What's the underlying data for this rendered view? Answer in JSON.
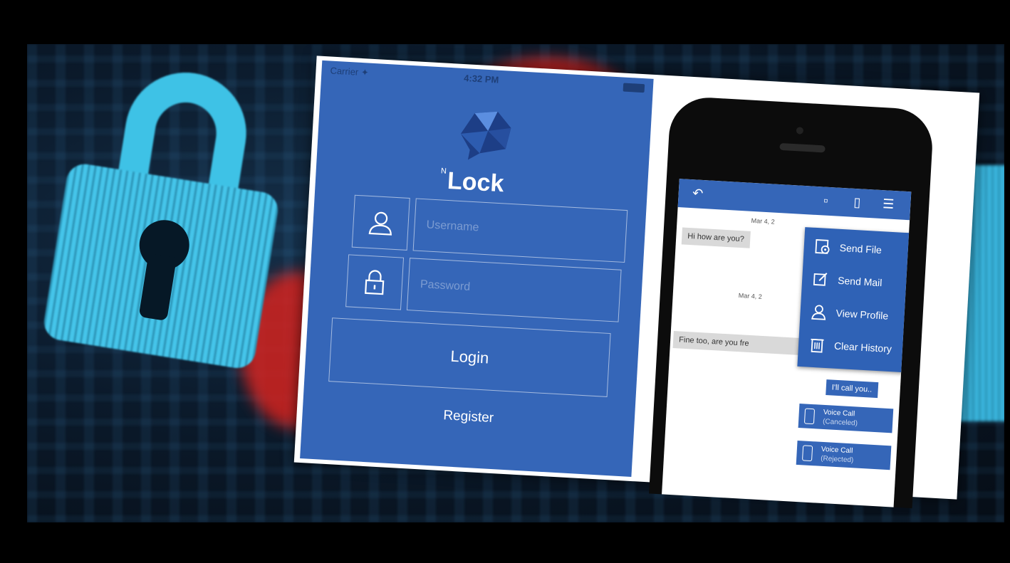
{
  "status_bar": {
    "carrier": "Carrier ✦",
    "time": "4:32 PM"
  },
  "brand": {
    "prefix": "N",
    "name": "Lock"
  },
  "login_form": {
    "username_placeholder": "Username",
    "password_placeholder": "Password",
    "login_label": "Login",
    "register_label": "Register"
  },
  "chat": {
    "dates": [
      "Mar 4, 2",
      "Mar 4, 2"
    ],
    "incoming": [
      "Hi how are you?",
      "Fine too, are you fre"
    ],
    "outgoing": [
      "I'll call you.."
    ],
    "calls": [
      {
        "title": "Voice Call",
        "status": "(Canceled)"
      },
      {
        "title": "Voice Call",
        "status": "(Rejected)"
      }
    ],
    "menu": [
      {
        "label": "Send File",
        "icon": "send-file-icon"
      },
      {
        "label": "Send Mail",
        "icon": "edit-icon"
      },
      {
        "label": "View Profile",
        "icon": "user-icon"
      },
      {
        "label": "Clear History",
        "icon": "trash-icon"
      }
    ]
  },
  "colors": {
    "app_blue": "#3566b8",
    "lock_cyan": "#45c5ea",
    "alert_red": "#d4231f"
  }
}
